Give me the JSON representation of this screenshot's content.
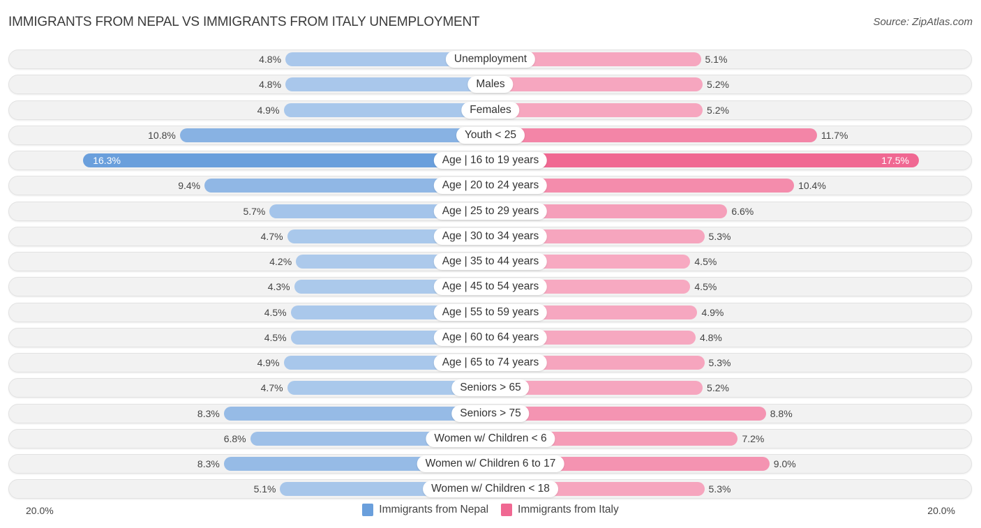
{
  "chart_data": {
    "type": "bar",
    "orientation": "horizontal-diverging",
    "title": "IMMIGRANTS FROM NEPAL VS IMMIGRANTS FROM ITALY UNEMPLOYMENT",
    "source": "Source: ZipAtlas.com",
    "categories": [
      "Unemployment",
      "Males",
      "Females",
      "Youth < 25",
      "Age | 16 to 19 years",
      "Age | 20 to 24 years",
      "Age | 25 to 29 years",
      "Age | 30 to 34 years",
      "Age | 35 to 44 years",
      "Age | 45 to 54 years",
      "Age | 55 to 59 years",
      "Age | 60 to 64 years",
      "Age | 65 to 74 years",
      "Seniors > 65",
      "Seniors > 75",
      "Women w/ Children < 6",
      "Women w/ Children 6 to 17",
      "Women w/ Children < 18"
    ],
    "series": [
      {
        "name": "Immigrants from Nepal",
        "color": "#6a9fdc",
        "side": "left",
        "values": [
          4.8,
          4.8,
          4.9,
          10.8,
          16.3,
          9.4,
          5.7,
          4.7,
          4.2,
          4.3,
          4.5,
          4.5,
          4.9,
          4.7,
          8.3,
          6.8,
          8.3,
          5.1
        ]
      },
      {
        "name": "Immigrants from Italy",
        "color": "#f06892",
        "side": "right",
        "values": [
          5.1,
          5.2,
          5.2,
          11.7,
          17.5,
          10.4,
          6.6,
          5.3,
          4.5,
          4.5,
          4.9,
          4.8,
          5.3,
          5.2,
          8.8,
          7.2,
          9.0,
          5.3
        ]
      }
    ],
    "value_suffix": "%",
    "axis_min_label": "20.0%",
    "axis_max_label": "20.0%",
    "xlim": [
      -20,
      20
    ],
    "legend_position": "bottom-center"
  }
}
